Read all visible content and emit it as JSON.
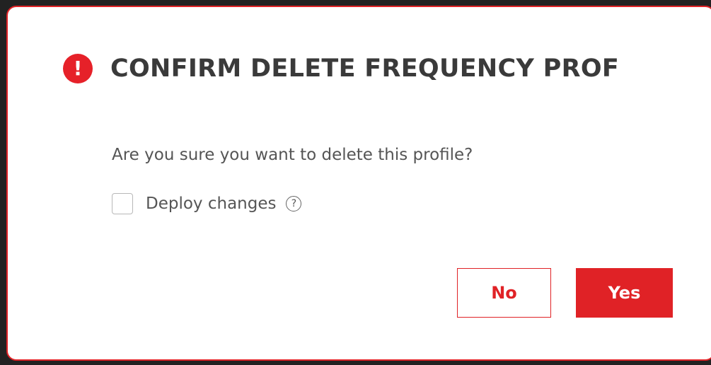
{
  "dialog": {
    "icon": "alert-icon",
    "icon_glyph": "!",
    "title": "CONFIRM DELETE FREQUENCY PROF",
    "message": "Are you sure you want to delete this profile?",
    "deploy": {
      "label": "Deploy changes",
      "checked": false,
      "help_glyph": "?"
    },
    "buttons": {
      "no_label": "No",
      "yes_label": "Yes"
    }
  },
  "colors": {
    "accent": "#e02226",
    "title_text": "#3a3a3a",
    "body_text": "#555555"
  }
}
